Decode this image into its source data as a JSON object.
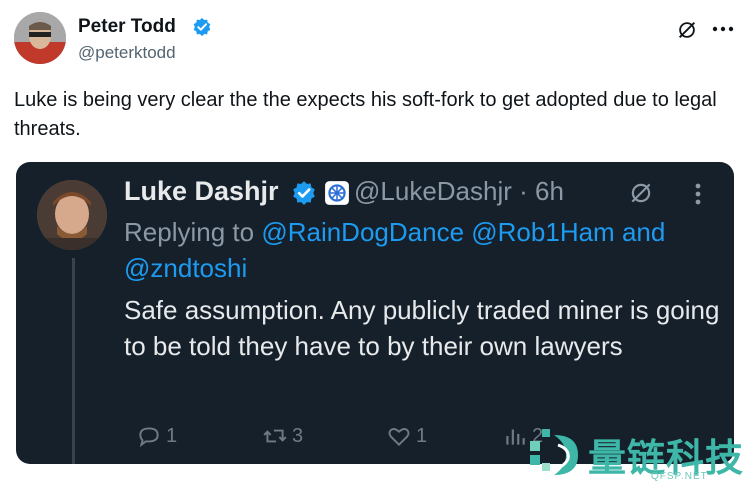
{
  "post": {
    "author_name": "Peter Todd",
    "author_handle": "@peterktodd",
    "text": "Luke is being very clear the the expects his soft-fork to get adopted due to legal threats."
  },
  "quoted": {
    "author_name": "Luke Dashjr",
    "handle_time": "@LukeDashjr · 6h",
    "replying_prefix": "Replying to",
    "mention_1": "@RainDogDance",
    "mention_2": "@Rob1Ham",
    "mention_and": "and",
    "mention_3": "@zndtoshi",
    "text": "Safe assumption. Any publicly traded miner is going to be told they have to by their own lawyers",
    "actions": {
      "reply_count": "1",
      "repost_count": "3",
      "like_count": "1",
      "views_count": "2"
    }
  },
  "watermark": {
    "title": "量链科技",
    "subtitle": "QFSP.NET"
  },
  "colors": {
    "accent": "#1d9bf0",
    "dark_bg": "#15202b",
    "watermark": "#3eb7a8"
  },
  "icons": [
    "verified-badge-icon",
    "grok-icon",
    "more-icon",
    "affiliate-icon",
    "reply-icon",
    "repost-icon",
    "like-icon",
    "views-icon",
    "watermark-logo-icon"
  ]
}
